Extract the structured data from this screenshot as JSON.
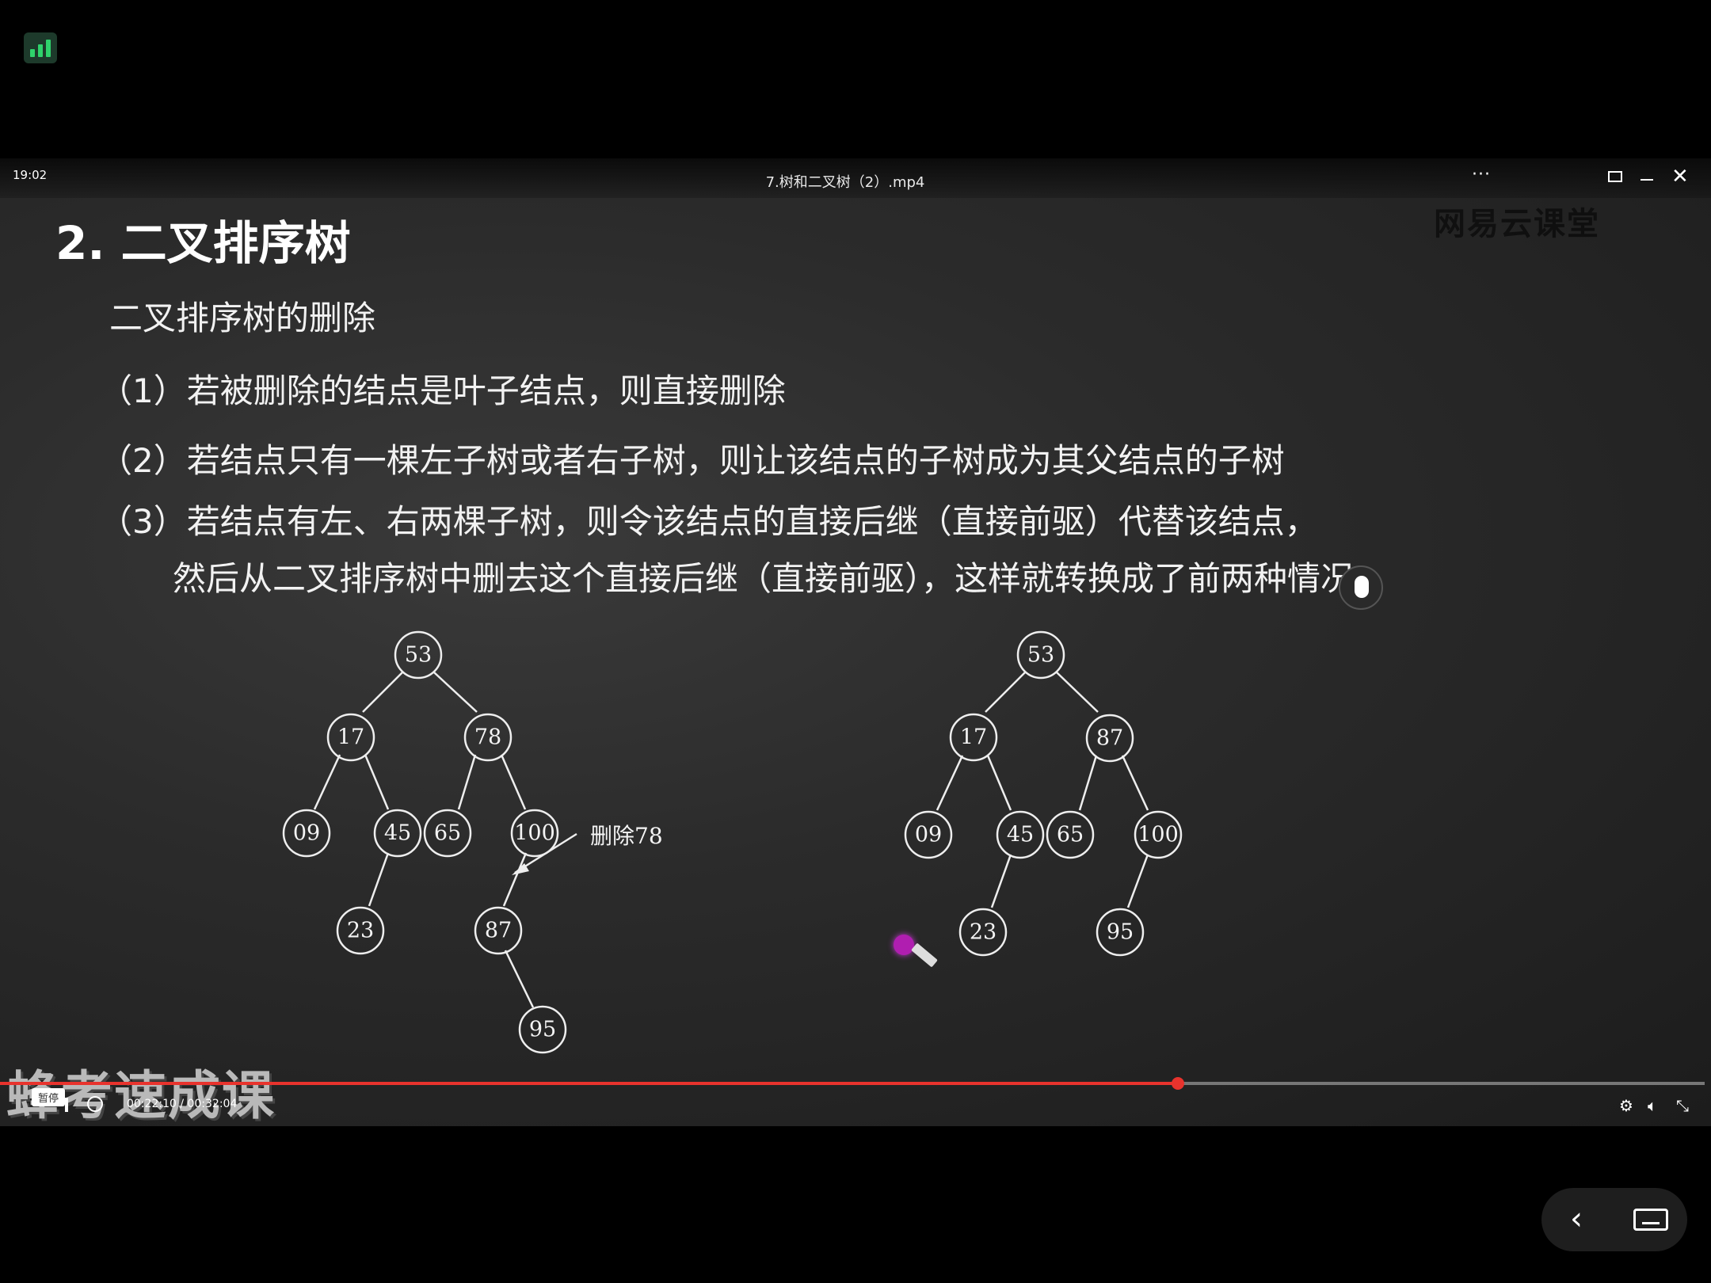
{
  "status_bar": {
    "app_icon": "bar-chart-icon"
  },
  "player": {
    "clock": "19:02",
    "title": "7.树和二叉树（2）.mp4",
    "more_label": "···",
    "close_label": "✕",
    "watermark": "网易云课堂"
  },
  "slide": {
    "title": "2. 二叉排序树",
    "subtitle": "二叉排序树的删除",
    "rules": [
      "（1）若被删除的结点是叶子结点，则直接删除",
      "（2）若结点只有一棵左子树或者右子树，则让该结点的子树成为其父结点的子树",
      "（3）若结点有左、右两棵子树，则令该结点的直接后继（直接前驱）代替该结点，",
      "然后从二叉排序树中删去这个直接后继（直接前驱），这样就转换成了前两种情况"
    ],
    "delete_label": "删除78",
    "tree_before": [
      "53",
      "17",
      "78",
      "09",
      "45",
      "65",
      "100",
      "23",
      "87",
      "95"
    ],
    "tree_after": [
      "53",
      "17",
      "87",
      "09",
      "45",
      "65",
      "100",
      "23",
      "95"
    ]
  },
  "overlay": {
    "brand": "蜂考速成课"
  },
  "controls": {
    "pause_tooltip": "暂停",
    "time": "00:22:10 / 00:32:04",
    "progress_fraction": 0.691,
    "settings_icon": "gear-icon",
    "volume_icon": "speaker-icon",
    "fullscreen_icon": "exit-fullscreen-icon"
  },
  "floating": {
    "back_label": "‹",
    "keyboard_icon": "keyboard-icon"
  },
  "colors": {
    "accent": "#e8332d",
    "background": "#2b2b2b"
  }
}
